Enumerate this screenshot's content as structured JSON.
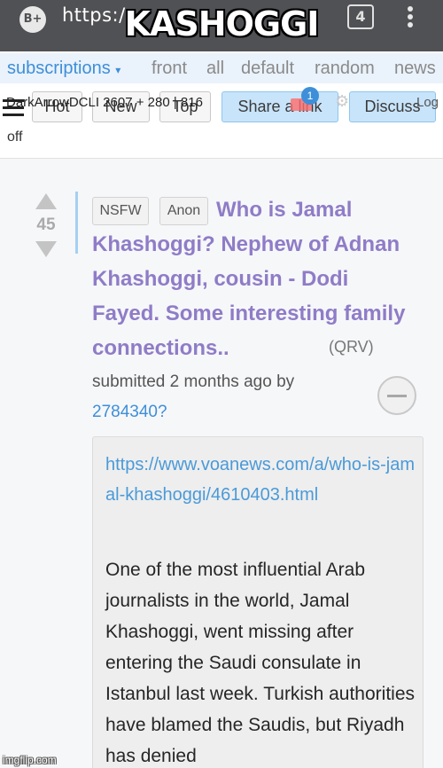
{
  "browser": {
    "logo_text": "B+",
    "url_text": "https:/",
    "tab_count": "4"
  },
  "meme_caption": "KASHOGGI",
  "nav": {
    "subscriptions": "subscriptions",
    "links": [
      "front",
      "all",
      "default",
      "random",
      "news"
    ]
  },
  "toolbar": {
    "user_line": "DarkArrowDCLI 2607 + 280 | 816",
    "mail_count": "1",
    "sort_buttons": [
      "Hot",
      "New",
      "Top"
    ],
    "share_label": "Share a link",
    "discuss_label": "Discuss",
    "logoff_tail": "Log",
    "off_text": "off"
  },
  "post": {
    "score": "45",
    "tags": [
      "NSFW",
      "Anon"
    ],
    "title": "Who is Jamal Khashoggi? Nephew of Adnan Khashoggi, cousin - Dodi Fayed. Some interesting family connections..",
    "domain": "(QRV)",
    "submitted": "submitted 2 months ago by",
    "author": "2784340?",
    "link_url": "https://www.voanews.com/a/who-is-jamal-khashoggi/4610403.html",
    "excerpt": "One of the most influential Arab journalists in the world, Jamal Khashoggi, went missing after entering the Saudi consulate in Istanbul last week. Turkish authorities have blamed the Saudis, but Riyadh has denied"
  },
  "watermark": "imgflip.com",
  "colors": {
    "title": "#8f7cc7",
    "link": "#3d8fd9",
    "chrome": "#505154"
  }
}
